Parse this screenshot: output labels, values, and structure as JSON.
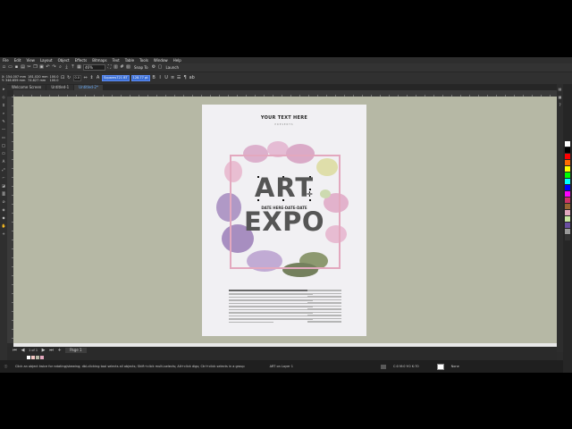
{
  "menu": [
    "File",
    "Edit",
    "View",
    "Layout",
    "Object",
    "Effects",
    "Bitmaps",
    "Text",
    "Table",
    "Tools",
    "Window",
    "Help"
  ],
  "toolbar": {
    "zoom": "46%",
    "snap_label": "Snap To",
    "launch_label": "Launch"
  },
  "property_bar": {
    "x": "X: 154.007 mm",
    "y": "Y: 346.659 mm",
    "width": "181.020 mm",
    "height": "74.827 mm",
    "scale_w": "100.0",
    "scale_h": "100.0",
    "angle": "0.0",
    "font_name": "Squares721 BT",
    "font_size": "128.77 pt"
  },
  "tabs": [
    "Welcome Screen",
    "Untitled-1",
    "Untitled-2*"
  ],
  "page_nav": {
    "counter": "1 of 1",
    "page_label": "Page 1"
  },
  "poster": {
    "header": "YOUR TEXT HERE",
    "subheader": "PRESENTS",
    "title_line1": "ART",
    "date_text": "DATE HERE-DATE-DATE",
    "title_line2": "EXPO"
  },
  "status": {
    "hint": "Click an object twice for rotating/skewing; dbl-clicking tool selects all objects; Shift+click multi-selects; Alt+click digs; Ctrl+click selects in a group",
    "layer": "ART on Layer 1",
    "fill_info": "C:0 M:0 Y:0 K:70",
    "outline_info": "None"
  },
  "colors": {
    "canvas_bg": "#b6b8a5",
    "poster_bg": "#f1f0f3",
    "frame_pink": "#e3a8be",
    "title_gray": "#555555",
    "active_tab": "#6cb0ff",
    "palette": [
      "#ffffff",
      "#000000",
      "#ff0000",
      "#ff6a00",
      "#ffff00",
      "#00ff00",
      "#00ffff",
      "#0000ff",
      "#ff00ff",
      "#cc3366",
      "#996633",
      "#e3a8be",
      "#c8e6a0",
      "#6a4fa0",
      "#999999",
      "#333333"
    ],
    "doc_swatches": [
      "#ffffff",
      "#f4c7c3",
      "#b6b8a5",
      "#e3a8be"
    ]
  }
}
